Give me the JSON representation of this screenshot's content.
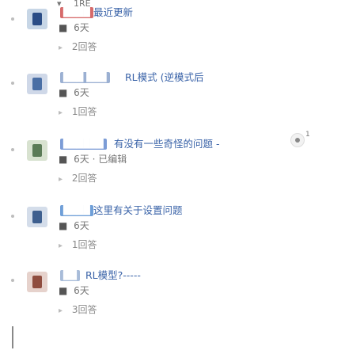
{
  "top_row": {
    "left": "▾",
    "right": "1RE"
  },
  "colors": {
    "link": "#3a63a8",
    "reply_arrow": "#bbbbbb",
    "edge_dot": "#bdbdbd"
  },
  "items": [
    {
      "user": "████",
      "user_color": "#d66a6a",
      "avatar_bg": "#c7d6e6",
      "avatar_fg": "#2b4d86",
      "title": "最近更新",
      "meta_mark": "■",
      "meta_text": "6天",
      "reply_arrow": "▸",
      "reply_count": "2回答"
    },
    {
      "user": "███ ███",
      "user_color": "#9bb0d2",
      "avatar_bg": "#cfd8e8",
      "avatar_fg": "#4a6fa5",
      "title": "RL模式 (逆模式后",
      "meta_mark": "■",
      "meta_text": "6天",
      "reply_arrow": "▸",
      "reply_count": "1回答"
    },
    {
      "user": "██████",
      "user_color": "#7c9cd6",
      "avatar_bg": "#d8e2d0",
      "avatar_fg": "#5b7b57",
      "title": "有没有一些奇怪的问题 -",
      "meta_mark": "■",
      "meta_text": "6天 · 已编辑",
      "reply_arrow": "▸",
      "reply_count": "2回答"
    },
    {
      "user": "████",
      "user_color": "#6f9fd8",
      "avatar_bg": "#d4ddea",
      "avatar_fg": "#3e5f8f",
      "title": "这里有关于设置问题",
      "meta_mark": "■",
      "meta_text": "6天",
      "reply_arrow": "▸",
      "reply_count": "1回答",
      "badge_count": "1"
    },
    {
      "user": "██",
      "user_color": "#a8bcd9",
      "avatar_bg": "#e6d2cc",
      "avatar_fg": "#8f4d3f",
      "title": "RL模型?-----",
      "meta_mark": "■",
      "meta_text": "6天",
      "reply_arrow": "▸",
      "reply_count": "3回答"
    }
  ]
}
